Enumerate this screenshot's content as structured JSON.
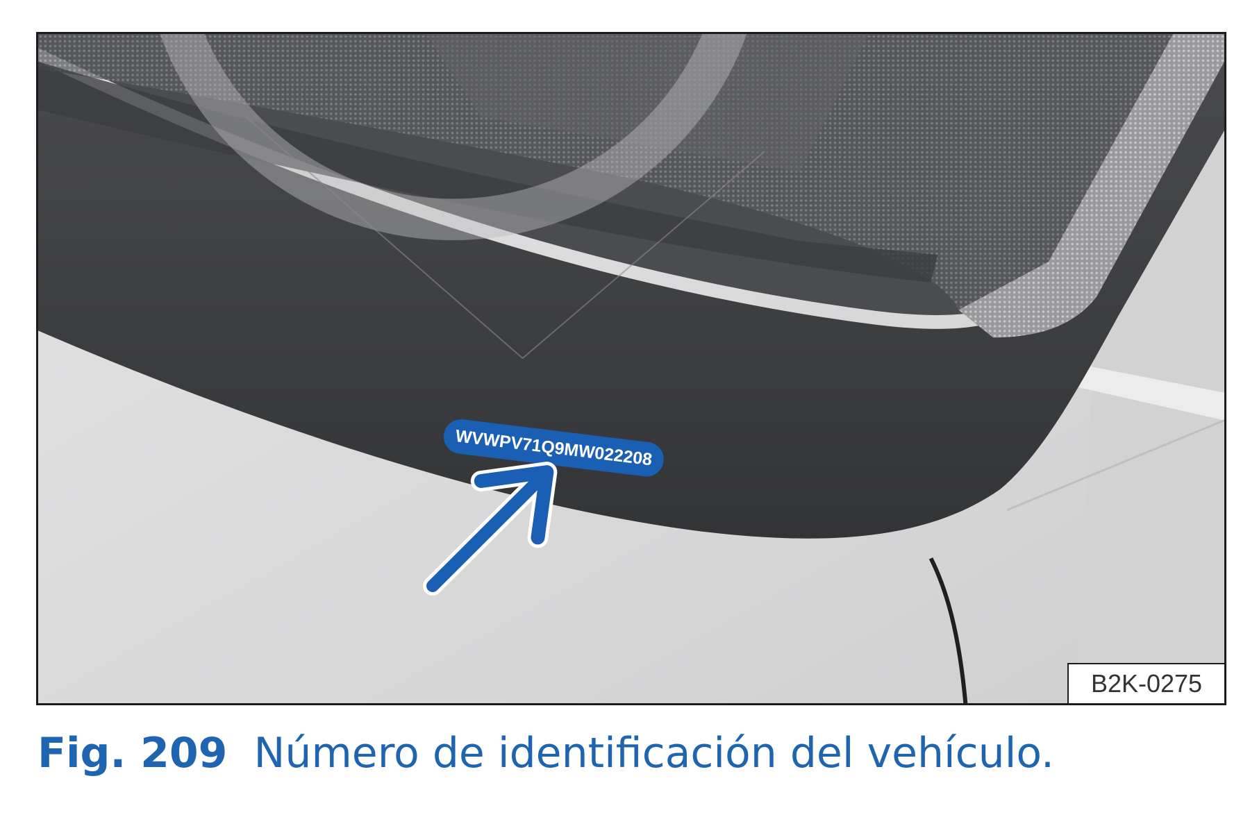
{
  "figure": {
    "vin_plate_text": "WVWPV71Q9MW022208",
    "reference_code": "B2K-0275",
    "colors": {
      "accent_blue": "#1a5fb4",
      "caption_blue": "#1f64b0",
      "dashboard_dark": "#3a3b3d",
      "body_light": "#d9d9d9"
    },
    "icons": [
      "arrow-pointer-icon",
      "steering-wheel-silhouette"
    ]
  },
  "caption": {
    "number": "Fig. 209",
    "text": "Número de identificación del vehículo."
  }
}
